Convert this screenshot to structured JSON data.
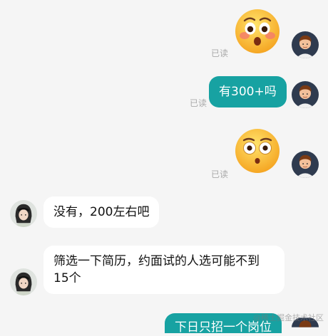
{
  "messages": [
    {
      "id": "m1",
      "side": "right",
      "kind": "emoji",
      "emoji": "blush-surprised-face",
      "read": "已读"
    },
    {
      "id": "m2",
      "side": "right",
      "kind": "text",
      "text": "有300+吗",
      "read": "已读"
    },
    {
      "id": "m3",
      "side": "right",
      "kind": "emoji",
      "emoji": "flushed-face",
      "read": "已读"
    },
    {
      "id": "m4",
      "side": "left",
      "kind": "text",
      "text": "没有，200左右吧"
    },
    {
      "id": "m5",
      "side": "left",
      "kind": "text",
      "text": "筛选一下简历，约面试的人选可能不到15个"
    },
    {
      "id": "m6",
      "side": "right",
      "kind": "text",
      "text": "下日只招一个岗位"
    }
  ],
  "watermark": "@稀土掘金技术社区",
  "colors": {
    "outgoing_bubble": "#17a2a2",
    "background": "#f5f5f5",
    "incoming_bubble": "#ffffff"
  }
}
